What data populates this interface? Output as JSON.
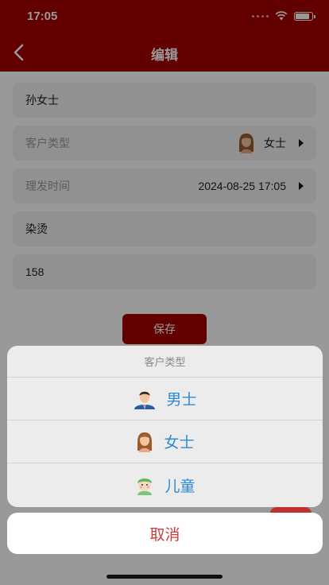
{
  "status_bar": {
    "time": "17:05",
    "battery_level": 0.9
  },
  "nav": {
    "title": "编辑",
    "back_icon": "chevron-left-icon"
  },
  "form": {
    "name_value": "孙女士",
    "customer_type_label": "客户类型",
    "customer_type_value": "女士",
    "customer_type_icon": "woman-avatar-icon",
    "haircut_time_label": "理发时间",
    "haircut_time_value": "2024-08-25 17:05",
    "service_value": "染烫",
    "price_value": "158",
    "save_label": "保存"
  },
  "action_sheet": {
    "title": "客户类型",
    "options": [
      {
        "label": "男士",
        "icon": "man-avatar-icon"
      },
      {
        "label": "女士",
        "icon": "woman-avatar-icon"
      },
      {
        "label": "儿童",
        "icon": "child-avatar-icon"
      }
    ],
    "cancel_label": "取消"
  },
  "colors": {
    "brand": "#a30000",
    "option_text": "#2e88d6",
    "cancel_text": "#d23a3a"
  }
}
